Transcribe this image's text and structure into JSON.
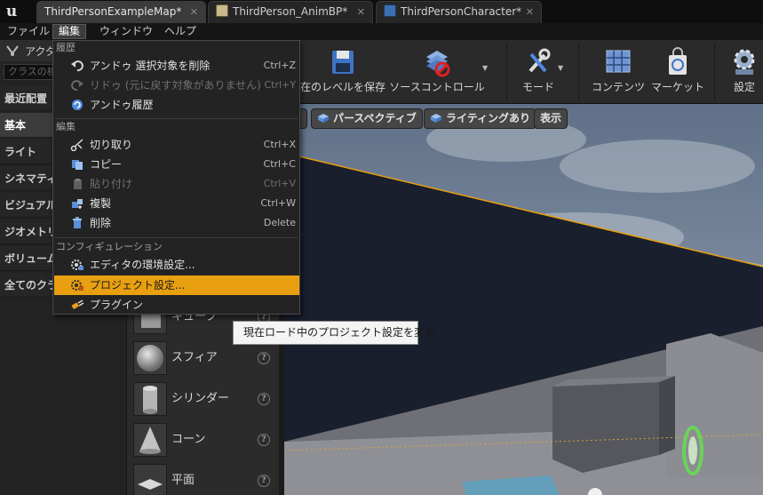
{
  "tabs": [
    {
      "label": "ThirdPersonExampleMap*"
    },
    {
      "label": "ThirdPerson_AnimBP*"
    },
    {
      "label": "ThirdPersonCharacter*"
    }
  ],
  "menubar": [
    "ファイル",
    "編集",
    "ウィンドウ",
    "ヘルプ"
  ],
  "left_panel": {
    "header_label": "アクタ",
    "search_placeholder": "クラスの検",
    "categories": [
      "最近配置",
      "基本",
      "ライト",
      "シネマティ",
      "ビジュアル",
      "ジオメトリ",
      "ボリューム",
      "全てのクラ"
    ]
  },
  "placement_items": [
    {
      "label": "キューブ",
      "icon": "cube-icon"
    },
    {
      "label": "スフィア",
      "icon": "sphere-icon"
    },
    {
      "label": "シリンダー",
      "icon": "cylinder-icon"
    },
    {
      "label": "コーン",
      "icon": "cone-icon"
    },
    {
      "label": "平面",
      "icon": "plane-icon"
    }
  ],
  "help_glyph": "?",
  "toolbar": {
    "save_current": "在のレベルを保存",
    "source_control": "ソースコントロール",
    "modes": "モード",
    "content": "コンテンツ",
    "market": "マーケット",
    "settings": "設定"
  },
  "viewport": {
    "perspective": "パースペクティブ",
    "lighting": "ライティングあり",
    "show": "表示"
  },
  "edit_menu": {
    "sections": [
      {
        "header": "履歴",
        "items": [
          {
            "label": "アンドゥ 選択対象を削除",
            "shortcut": "Ctrl+Z",
            "enabled": true,
            "icon": "undo-icon"
          },
          {
            "label": "リドゥ (元に戻す対象がありません)",
            "shortcut": "Ctrl+Y",
            "enabled": false,
            "icon": "redo-icon"
          },
          {
            "label": "アンドゥ履歴",
            "shortcut": "",
            "enabled": true,
            "icon": "undo-history-icon"
          }
        ]
      },
      {
        "header": "編集",
        "items": [
          {
            "label": "切り取り",
            "shortcut": "Ctrl+X",
            "enabled": true,
            "icon": "cut-icon"
          },
          {
            "label": "コピー",
            "shortcut": "Ctrl+C",
            "enabled": true,
            "icon": "copy-icon"
          },
          {
            "label": "貼り付け",
            "shortcut": "Ctrl+V",
            "enabled": false,
            "icon": "paste-icon"
          },
          {
            "label": "複製",
            "shortcut": "Ctrl+W",
            "enabled": true,
            "icon": "duplicate-icon"
          },
          {
            "label": "削除",
            "shortcut": "Delete",
            "enabled": true,
            "icon": "delete-icon"
          }
        ]
      },
      {
        "header": "コンフィギュレーション",
        "items": [
          {
            "label": "エディタの環境設定...",
            "shortcut": "",
            "enabled": true,
            "icon": "editor-preferences-icon"
          },
          {
            "label": "プロジェクト設定...",
            "shortcut": "",
            "enabled": true,
            "highlighted": true,
            "icon": "project-settings-icon"
          },
          {
            "label": "プラグイン",
            "shortcut": "",
            "enabled": true,
            "icon": "plugins-icon"
          }
        ]
      }
    ]
  },
  "tooltip": "現在ロード中のプロジェクト設定を変更",
  "colors": {
    "menu_highlight": "#e8a010",
    "window_background": "#151515"
  }
}
